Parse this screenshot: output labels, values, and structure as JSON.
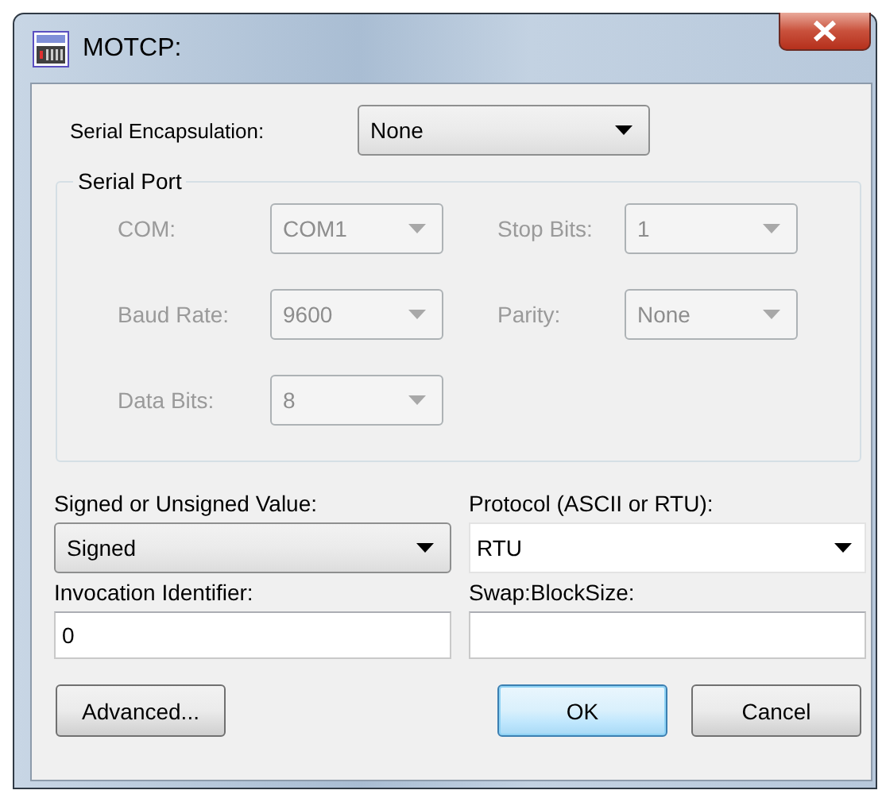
{
  "window": {
    "title": "MOTCP:"
  },
  "serial_encapsulation": {
    "label": "Serial Encapsulation:",
    "value": "None"
  },
  "serial_port": {
    "title": "Serial Port",
    "fields": [
      {
        "label": "COM:",
        "value": "COM1",
        "disabled": true
      },
      {
        "label": "Stop Bits:",
        "value": "1",
        "disabled": true
      },
      {
        "label": "Baud Rate:",
        "value": "9600",
        "disabled": true
      },
      {
        "label": "Parity:",
        "value": "None",
        "disabled": true
      },
      {
        "label": "Data Bits:",
        "value": "8",
        "disabled": true
      }
    ]
  },
  "fields": [
    {
      "label": "Signed or Unsigned Value:",
      "value": "Signed",
      "kind": "combo"
    },
    {
      "label": "Protocol (ASCII or RTU):",
      "value": "RTU",
      "kind": "dropdown"
    },
    {
      "label": "Invocation Identifier:",
      "value": "0",
      "kind": "text"
    },
    {
      "label": "Swap:BlockSize:",
      "kind": "text"
    }
  ],
  "buttons": [
    {
      "label": "Advanced...",
      "default": false
    },
    {
      "label": "OK",
      "default": true
    },
    {
      "label": "Cancel",
      "default": false
    }
  ]
}
